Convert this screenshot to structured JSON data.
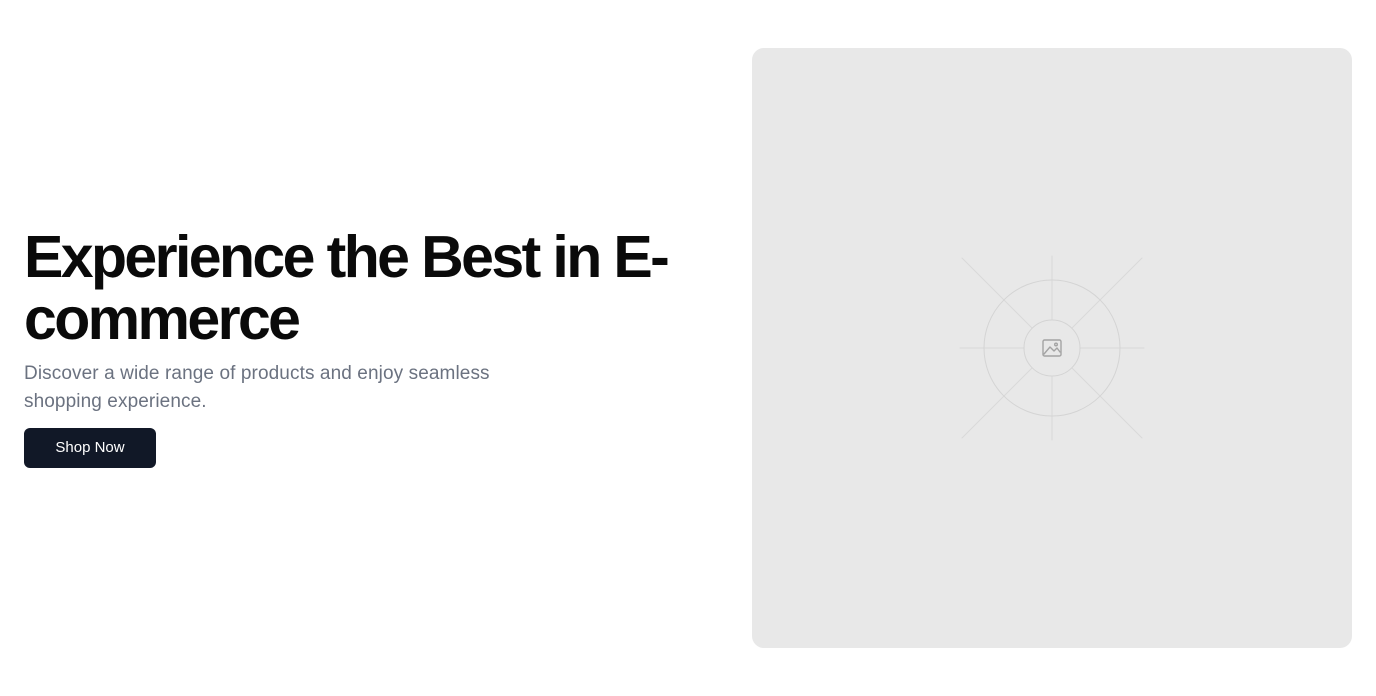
{
  "hero": {
    "title": "Experience the Best in E-commerce",
    "subtitle": "Discover a wide range of products and enjoy seamless shopping experience.",
    "cta_label": "Shop Now"
  },
  "image_placeholder": {
    "icon": "image-icon",
    "background_color": "#e8e8e8"
  },
  "colors": {
    "title": "#0a0a0a",
    "subtitle": "#6b7280",
    "button_background": "#111827",
    "button_text": "#ffffff"
  }
}
